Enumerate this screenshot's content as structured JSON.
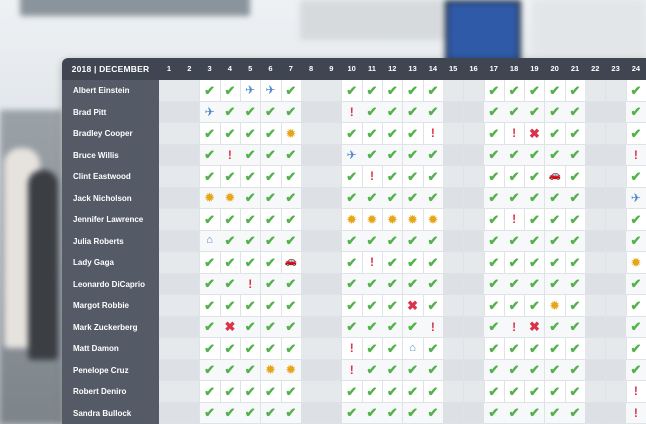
{
  "calendar": {
    "title": "2018 | DECEMBER",
    "days": [
      "1",
      "2",
      "3",
      "4",
      "5",
      "6",
      "7",
      "8",
      "9",
      "10",
      "11",
      "12",
      "13",
      "14",
      "15",
      "16",
      "17",
      "18",
      "19",
      "20",
      "21",
      "22",
      "23",
      "24"
    ],
    "weekend_days": [
      1,
      2,
      8,
      9,
      15,
      16,
      22,
      23
    ]
  },
  "legend_icons": {
    "C": "check-icon",
    "P": "plane-icon",
    "!": "warning-icon",
    "X": "sick-icon",
    "S": "sun-icon",
    "H": "home-icon",
    "A": "car-icon",
    "-": "empty"
  },
  "employees": [
    {
      "name": "Albert Einstein",
      "status": [
        "-",
        "-",
        "C",
        "C",
        "P",
        "P",
        "C",
        "-",
        "-",
        "C",
        "C",
        "C",
        "C",
        "C",
        "-",
        "-",
        "C",
        "C",
        "C",
        "C",
        "C",
        "-",
        "-",
        "C"
      ]
    },
    {
      "name": "Brad Pitt",
      "status": [
        "-",
        "-",
        "P",
        "C",
        "C",
        "C",
        "C",
        "-",
        "-",
        "!",
        "C",
        "C",
        "C",
        "C",
        "-",
        "-",
        "C",
        "C",
        "C",
        "C",
        "C",
        "-",
        "-",
        "C"
      ]
    },
    {
      "name": "Bradley Cooper",
      "status": [
        "-",
        "-",
        "C",
        "C",
        "C",
        "C",
        "S",
        "-",
        "-",
        "C",
        "C",
        "C",
        "C",
        "!",
        "-",
        "-",
        "C",
        "!",
        "X",
        "C",
        "C",
        "-",
        "-",
        "C"
      ]
    },
    {
      "name": "Bruce Willis",
      "status": [
        "-",
        "-",
        "C",
        "!",
        "C",
        "C",
        "C",
        "-",
        "-",
        "P",
        "C",
        "C",
        "C",
        "C",
        "-",
        "-",
        "C",
        "C",
        "C",
        "C",
        "C",
        "-",
        "-",
        "!"
      ]
    },
    {
      "name": "Clint Eastwood",
      "status": [
        "-",
        "-",
        "C",
        "C",
        "C",
        "C",
        "C",
        "-",
        "-",
        "C",
        "!",
        "C",
        "C",
        "C",
        "-",
        "-",
        "C",
        "C",
        "C",
        "A",
        "C",
        "-",
        "-",
        "C"
      ]
    },
    {
      "name": "Jack Nicholson",
      "status": [
        "-",
        "-",
        "S",
        "S",
        "C",
        "C",
        "C",
        "-",
        "-",
        "C",
        "C",
        "C",
        "C",
        "C",
        "-",
        "-",
        "C",
        "C",
        "C",
        "C",
        "C",
        "-",
        "-",
        "P"
      ]
    },
    {
      "name": "Jennifer Lawrence",
      "status": [
        "-",
        "-",
        "C",
        "C",
        "C",
        "C",
        "C",
        "-",
        "-",
        "S",
        "S",
        "S",
        "S",
        "S",
        "-",
        "-",
        "C",
        "!",
        "C",
        "C",
        "C",
        "-",
        "-",
        "C"
      ]
    },
    {
      "name": "Julia Roberts",
      "status": [
        "-",
        "-",
        "H",
        "C",
        "C",
        "C",
        "C",
        "-",
        "-",
        "C",
        "C",
        "C",
        "C",
        "C",
        "-",
        "-",
        "C",
        "C",
        "C",
        "C",
        "C",
        "-",
        "-",
        "C"
      ]
    },
    {
      "name": "Lady Gaga",
      "status": [
        "-",
        "-",
        "C",
        "C",
        "C",
        "C",
        "A",
        "-",
        "-",
        "C",
        "!",
        "C",
        "C",
        "C",
        "-",
        "-",
        "C",
        "C",
        "C",
        "C",
        "C",
        "-",
        "-",
        "S"
      ]
    },
    {
      "name": "Leonardo DiCaprio",
      "status": [
        "-",
        "-",
        "C",
        "C",
        "!",
        "C",
        "C",
        "-",
        "-",
        "C",
        "C",
        "C",
        "C",
        "C",
        "-",
        "-",
        "C",
        "C",
        "C",
        "C",
        "C",
        "-",
        "-",
        "C"
      ]
    },
    {
      "name": "Margot Robbie",
      "status": [
        "-",
        "-",
        "C",
        "C",
        "C",
        "C",
        "C",
        "-",
        "-",
        "C",
        "C",
        "C",
        "X",
        "C",
        "-",
        "-",
        "C",
        "C",
        "C",
        "S",
        "C",
        "-",
        "-",
        "C"
      ]
    },
    {
      "name": "Mark Zuckerberg",
      "status": [
        "-",
        "-",
        "C",
        "X",
        "C",
        "C",
        "C",
        "-",
        "-",
        "C",
        "C",
        "C",
        "C",
        "!",
        "-",
        "-",
        "C",
        "!",
        "X",
        "C",
        "C",
        "-",
        "-",
        "C"
      ]
    },
    {
      "name": "Matt Damon",
      "status": [
        "-",
        "-",
        "C",
        "C",
        "C",
        "C",
        "C",
        "-",
        "-",
        "!",
        "C",
        "C",
        "H",
        "C",
        "-",
        "-",
        "C",
        "C",
        "C",
        "C",
        "C",
        "-",
        "-",
        "C"
      ]
    },
    {
      "name": "Penelope Cruz",
      "status": [
        "-",
        "-",
        "C",
        "C",
        "C",
        "S",
        "S",
        "-",
        "-",
        "!",
        "C",
        "C",
        "C",
        "C",
        "-",
        "-",
        "C",
        "C",
        "C",
        "C",
        "C",
        "-",
        "-",
        "C"
      ]
    },
    {
      "name": "Robert Deniro",
      "status": [
        "-",
        "-",
        "C",
        "C",
        "C",
        "C",
        "C",
        "-",
        "-",
        "C",
        "C",
        "C",
        "C",
        "C",
        "-",
        "-",
        "C",
        "C",
        "C",
        "C",
        "C",
        "-",
        "-",
        "!"
      ]
    },
    {
      "name": "Sandra Bullock",
      "status": [
        "-",
        "-",
        "C",
        "C",
        "C",
        "C",
        "C",
        "-",
        "-",
        "C",
        "C",
        "C",
        "C",
        "C",
        "-",
        "-",
        "C",
        "C",
        "C",
        "C",
        "C",
        "-",
        "-",
        "!"
      ]
    }
  ]
}
